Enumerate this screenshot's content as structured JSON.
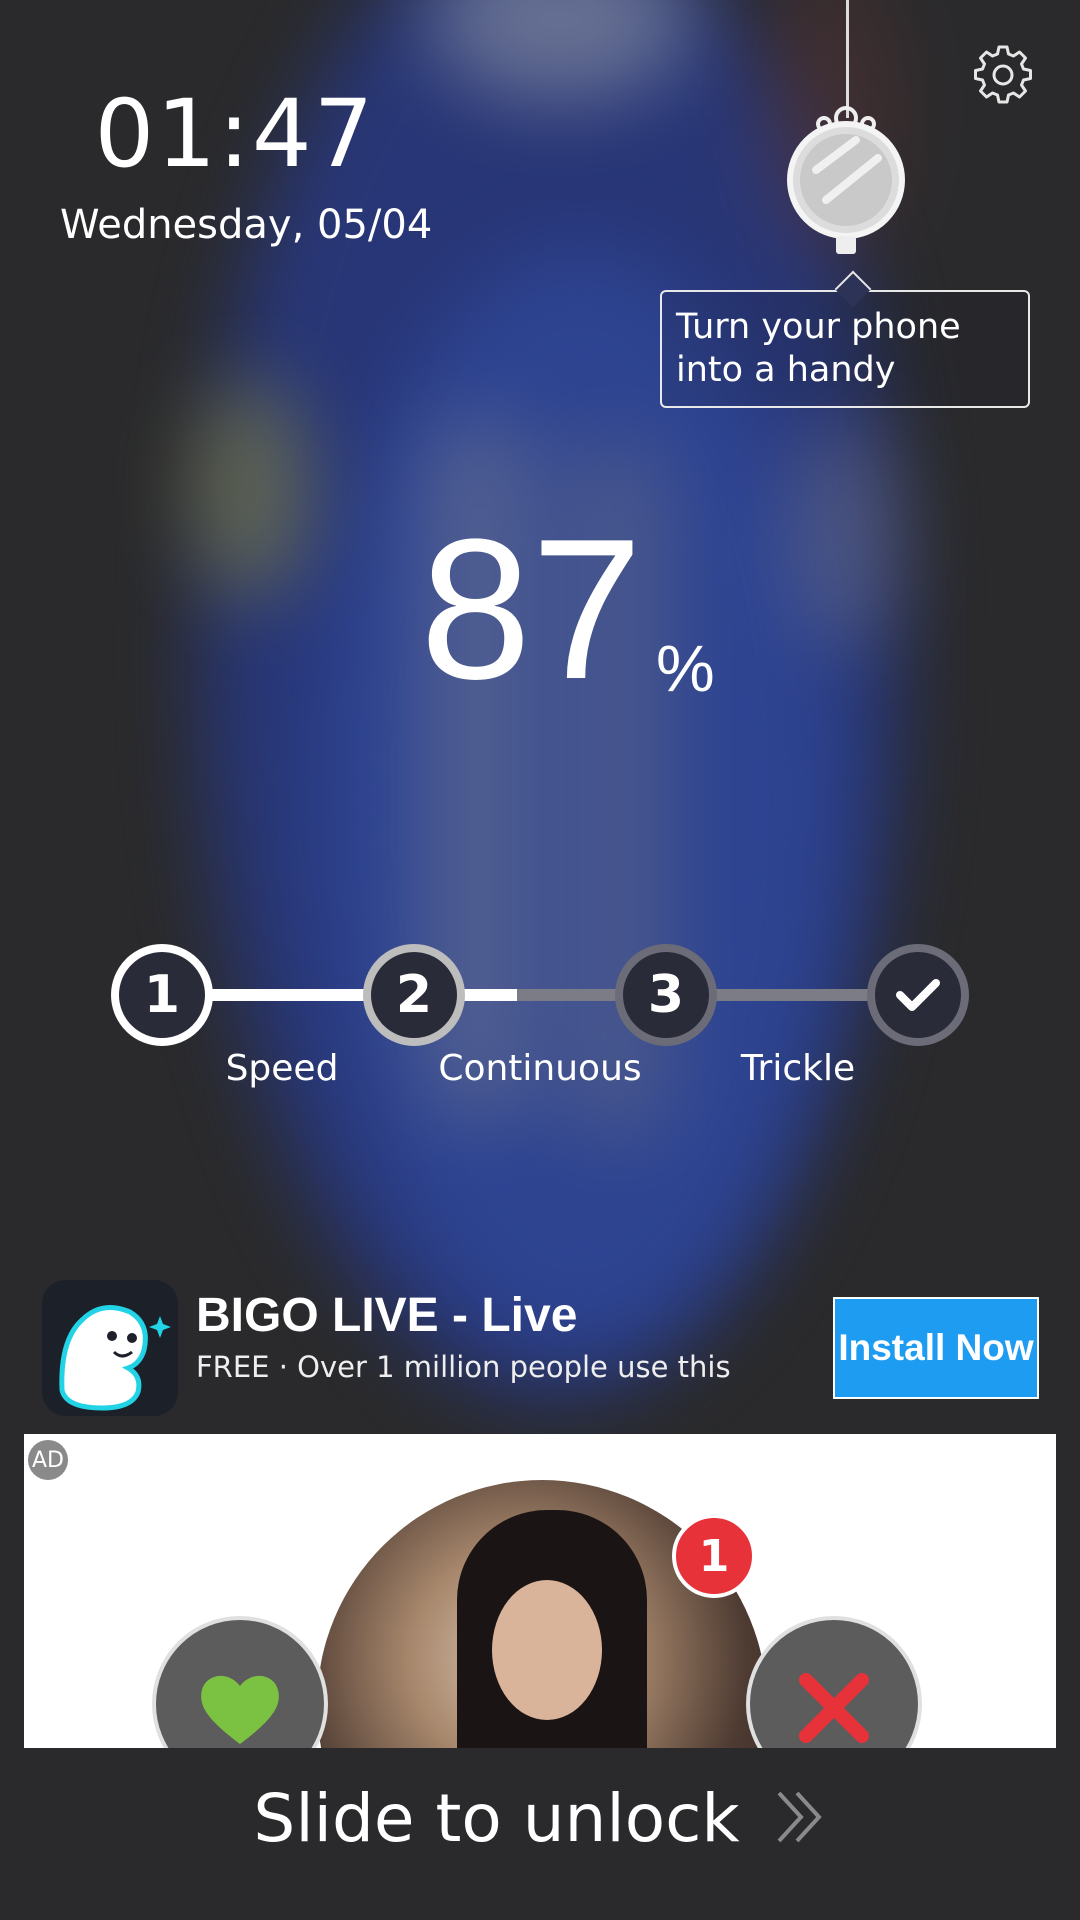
{
  "status": {
    "time": "01:47",
    "date": "Wednesday, 05/04"
  },
  "tooltip": {
    "line1": "Turn your phone",
    "line2": "into a handy"
  },
  "battery": {
    "percent": "87",
    "unit": "%"
  },
  "charging_steps": [
    {
      "number": "1",
      "label": "Speed"
    },
    {
      "number": "2",
      "label": "Continuous"
    },
    {
      "number": "3",
      "label": "Trickle"
    }
  ],
  "ad": {
    "title": "BIGO LIVE - Live",
    "subtitle": "FREE · Over 1 million people use this",
    "install_label": "Install Now",
    "badge": "AD",
    "notification_count": "1"
  },
  "unlock": {
    "label": "Slide to unlock"
  },
  "colors": {
    "install_button": "#1e9cf2",
    "notification_badge": "#e8323a",
    "like_heart": "#7cc242",
    "nope_x": "#e8323a"
  }
}
